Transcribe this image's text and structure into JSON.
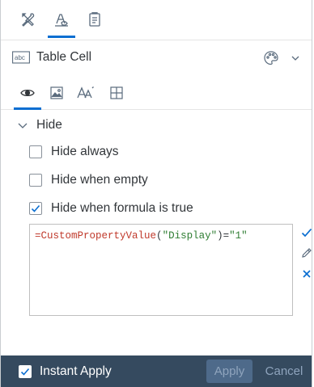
{
  "top_tabs": [
    {
      "name": "tools-icon",
      "active": false
    },
    {
      "name": "format-paint-icon",
      "active": true
    },
    {
      "name": "document-icon",
      "active": false
    }
  ],
  "panel": {
    "title": "Table Cell",
    "title_icon": "text-field-icon",
    "palette_icon": "palette-icon"
  },
  "sub_tabs": [
    {
      "name": "visibility-eye-icon",
      "active": true
    },
    {
      "name": "image-icon",
      "active": false
    },
    {
      "name": "text-style-icon",
      "active": false
    },
    {
      "name": "table-layout-icon",
      "active": false
    }
  ],
  "section": {
    "title": "Hide",
    "options": [
      {
        "label": "Hide always",
        "checked": false
      },
      {
        "label": "Hide when empty",
        "checked": false
      },
      {
        "label": "Hide when formula is true",
        "checked": true
      }
    ]
  },
  "formula": {
    "eq": "=",
    "function": "CustomPropertyValue",
    "open_paren": "(",
    "arg": "\"Display\"",
    "close": ")=",
    "value": "\"1\""
  },
  "footer": {
    "instant_apply_label": "Instant Apply",
    "instant_apply_checked": true,
    "apply_label": "Apply",
    "cancel_label": "Cancel"
  },
  "colors": {
    "accent": "#0a6ed1",
    "footer_bg": "#354a5f",
    "confirm": "#0a6ed1"
  }
}
